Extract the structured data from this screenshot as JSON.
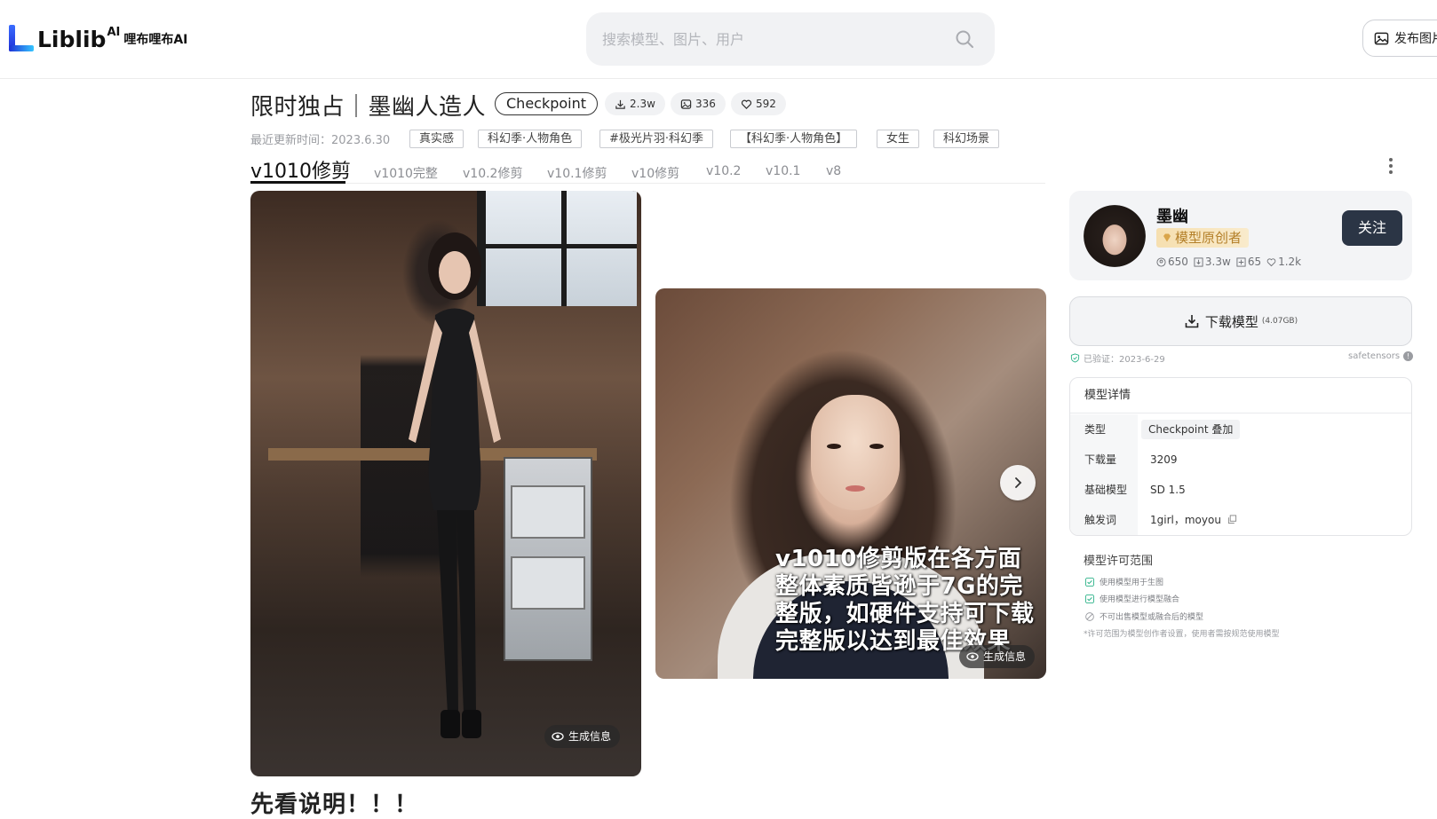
{
  "header": {
    "logo_text": "Liblib",
    "logo_sup": "AI",
    "logo_cn": "哩布哩布AI",
    "search_placeholder": "搜索模型、图片、用户",
    "publish_label": "发布图片"
  },
  "model": {
    "title": "限时独占｜墨幽人造人",
    "type_tag": "Checkpoint",
    "downloads": "2.3w",
    "images": "336",
    "likes": "592",
    "updated_label": "最近更新时间：2023.6.30",
    "tags": [
      "真实感",
      "科幻季·人物角色",
      "#极光片羽·科幻季",
      "【科幻季·人物角色】",
      "女生",
      "科幻场景"
    ]
  },
  "versions": {
    "active": "v1010修剪",
    "others": [
      "v1010完整",
      "v10.2修剪",
      "v10.1修剪",
      "v10修剪",
      "v10.2",
      "v10.1",
      "v8"
    ]
  },
  "gallery": {
    "gen_info_label": "生成信息",
    "overlay_text": "v1010修剪版在各方面整体素质皆逊于7G的完整版，如硬件支持可下载完整版以达到最佳效果"
  },
  "description": {
    "heading": "先看说明！！！"
  },
  "author": {
    "name": "墨幽",
    "badge": "模型原创者",
    "followers": "650",
    "downloads": "3.3w",
    "models": "65",
    "likes": "1.2k",
    "follow_label": "关注"
  },
  "download": {
    "label": "下载模型",
    "size": "(4.07GB)",
    "verified": "已验证：2023-6-29",
    "format": "safetensors"
  },
  "details": {
    "heading": "模型详情",
    "rows": [
      {
        "label": "类型",
        "value": "Checkpoint 叠加"
      },
      {
        "label": "下载量",
        "value": "3209"
      },
      {
        "label": "基础模型",
        "value": "SD 1.5"
      },
      {
        "label": "触发词",
        "value": "1girl，moyou"
      }
    ]
  },
  "license": {
    "title": "模型许可范围",
    "items": [
      "使用模型用于生图",
      "使用模型进行模型融合",
      "不可出售模型或融合后的模型"
    ],
    "note": "*许可范围为模型创作者设置，使用者需按规范使用模型"
  },
  "colors": {
    "accent_dark": "#2b3545",
    "badge_gold": "#b4802a",
    "check_green": "#2fb38a"
  }
}
